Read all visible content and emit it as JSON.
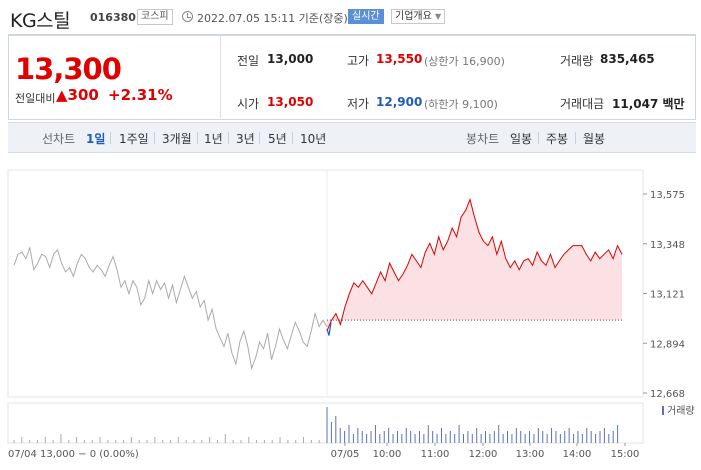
{
  "header": {
    "name": "KG스틸",
    "code": "016380",
    "market": "코스피",
    "timestamp": "2022.07.05 15:11 기준(장중)",
    "realtime": "실시간",
    "company_info": "기업개요",
    "icons": {
      "clock": "clock-icon",
      "dropdown": "chevron-down-icon"
    }
  },
  "quote": {
    "price": "13,300",
    "change_label": "전일대비",
    "change_arrow": "▲",
    "change_abs": "300",
    "change_pct": "+2.31%",
    "prev_close": {
      "label": "전일",
      "value": "13,000"
    },
    "open": {
      "label": "시가",
      "value": "13,050"
    },
    "high": {
      "label": "고가",
      "value": "13,550",
      "sub": "(상한가 16,900)"
    },
    "low": {
      "label": "저가",
      "value": "12,900",
      "sub": "(하한가 9,100)"
    },
    "volume": {
      "label": "거래량",
      "value": "835,465"
    },
    "amount": {
      "label": "거래대금",
      "value": "11,047 백만"
    },
    "colors": {
      "up": "#e00000",
      "down": "#1f5bbf"
    }
  },
  "periods": {
    "line_label": "선차트",
    "line_items": [
      "1일",
      "1주일",
      "3개월",
      "1년",
      "3년",
      "5년",
      "10년"
    ],
    "active": "1일",
    "candle_label": "봉차트",
    "candle_items": [
      "일봉",
      "주봉",
      "월봉"
    ]
  },
  "chart_data": {
    "type": "line",
    "y_ticks": [
      "13,575",
      "13,348",
      "13,121",
      "12,894",
      "12,668"
    ],
    "ylim": [
      12668,
      13575
    ],
    "x_ticks": [
      "07/05",
      "10:00",
      "11:00",
      "12:00",
      "13:00",
      "14:00",
      "15:00"
    ],
    "prev_day_label": "07/04 13,000 − 0 (0.00%)",
    "volume_label": "거래량",
    "reference_price": 13000,
    "series": [
      {
        "name": "07/04",
        "color": "#aaaaaa",
        "values": [
          13250,
          13300,
          13310,
          13280,
          13330,
          13230,
          13260,
          13300,
          13290,
          13240,
          13300,
          13320,
          13260,
          13220,
          13240,
          13200,
          13260,
          13300,
          13280,
          13240,
          13220,
          13250,
          13230,
          13200,
          13250,
          13290,
          13230,
          13150,
          13180,
          13120,
          13180,
          13150,
          13070,
          13100,
          13180,
          13120,
          13180,
          13140,
          13170,
          13100,
          13160,
          13080,
          13140,
          13200,
          13150,
          13100,
          13130,
          13060,
          13090,
          13000,
          13050,
          12960,
          12920,
          12880,
          12940,
          12850,
          12800,
          12900,
          12950,
          12880,
          12780,
          12830,
          12900,
          12870,
          12940,
          12820,
          12880,
          12960,
          12910,
          12870,
          12930,
          12990,
          12950,
          12900,
          12880,
          12950,
          13030,
          12970,
          13000,
          12970
        ]
      },
      {
        "name": "07/05",
        "color": "#e00000",
        "values": [
          12950,
          13000,
          13030,
          12980,
          13060,
          13120,
          13170,
          13150,
          13180,
          13150,
          13120,
          13170,
          13220,
          13180,
          13260,
          13220,
          13180,
          13210,
          13250,
          13300,
          13270,
          13240,
          13310,
          13350,
          13300,
          13380,
          13320,
          13360,
          13420,
          13380,
          13470,
          13500,
          13550,
          13470,
          13400,
          13360,
          13340,
          13380,
          13300,
          13360,
          13280,
          13240,
          13270,
          13230,
          13270,
          13280,
          13250,
          13310,
          13270,
          13250,
          13300,
          13240,
          13270,
          13300,
          13320,
          13340,
          13340,
          13340,
          13300,
          13270,
          13310,
          13280,
          13300,
          13320,
          13280,
          13340,
          13300
        ]
      }
    ],
    "volume": {
      "prev": [
        1,
        2,
        1,
        1,
        2,
        1,
        3,
        1,
        2,
        1,
        1,
        2,
        1,
        1,
        1,
        2,
        1,
        1,
        2,
        1,
        1,
        2,
        1,
        1,
        1,
        2,
        1,
        3,
        1,
        1,
        2,
        1,
        1,
        1,
        2,
        1,
        1,
        2,
        1,
        1
      ],
      "today": [
        12,
        7,
        9,
        5,
        4,
        6,
        3,
        5,
        4,
        3,
        4,
        6,
        3,
        4,
        5,
        3,
        4,
        3,
        5,
        4,
        3,
        4,
        3,
        6,
        4,
        3,
        5,
        3,
        4,
        3,
        6,
        3,
        4,
        3,
        5,
        3,
        4,
        3,
        4,
        6,
        3,
        4,
        3,
        5,
        4,
        3,
        4,
        3,
        5,
        4,
        3,
        5,
        4,
        3,
        4,
        5,
        3,
        4,
        3,
        5,
        4,
        3,
        4,
        5,
        3,
        4,
        6
      ]
    }
  }
}
